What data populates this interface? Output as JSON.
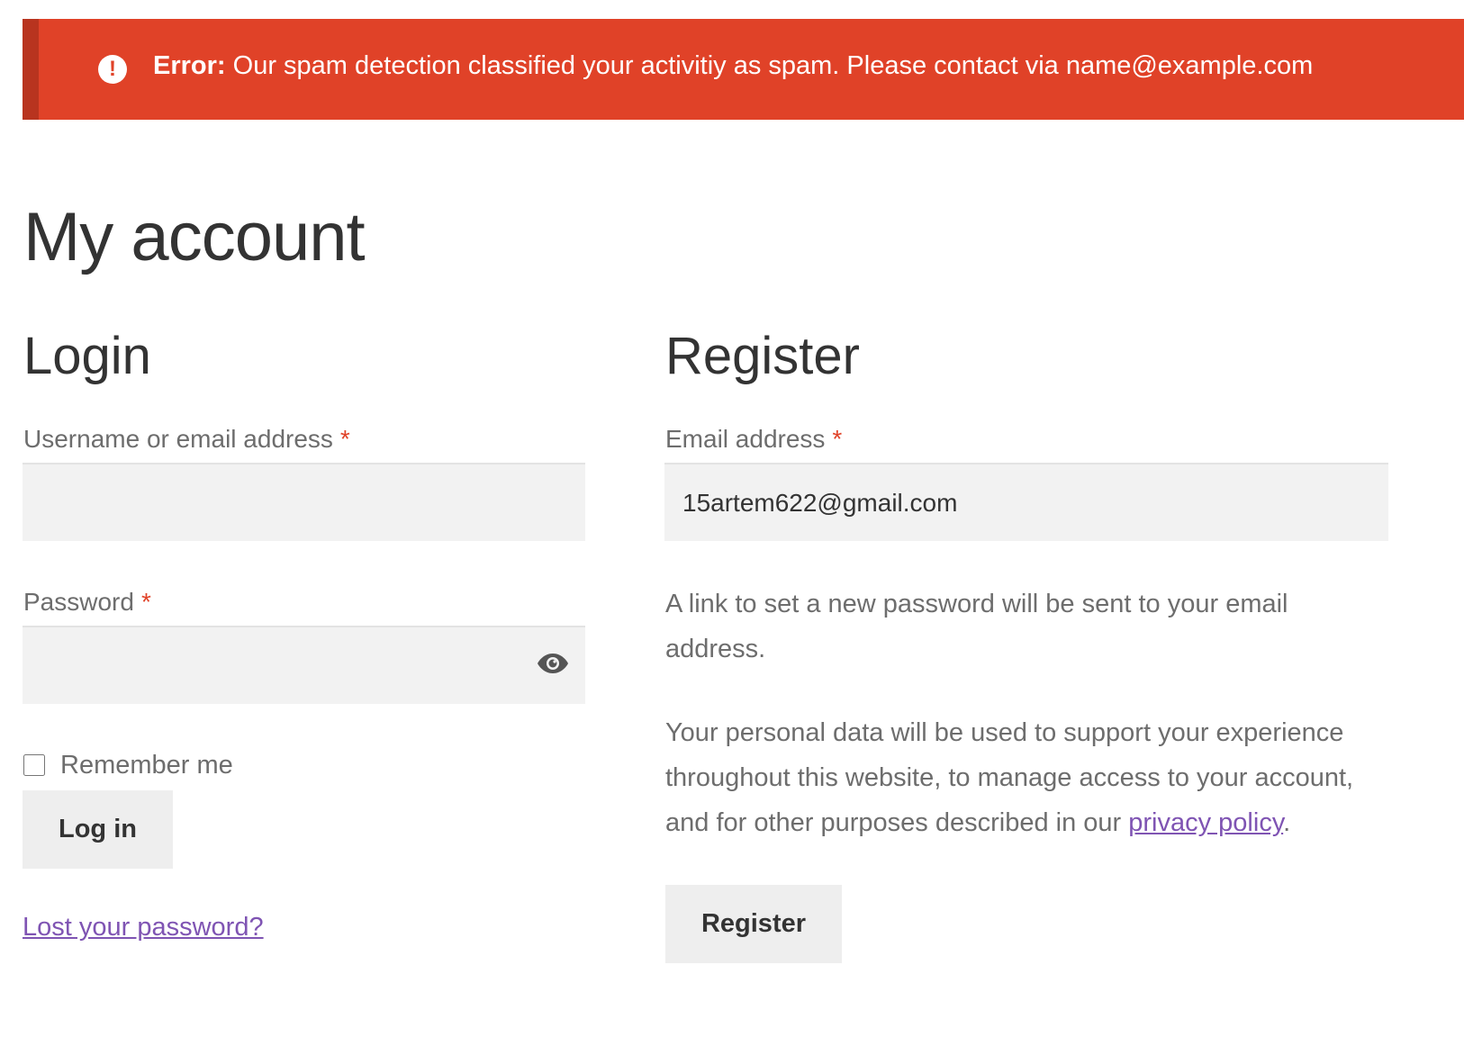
{
  "alert": {
    "label": "Error:",
    "message": "Our spam detection classified your activitiy as spam. Please contact via name@example.com",
    "icon": "exclamation-circle-icon",
    "color": "#e04228"
  },
  "page": {
    "title": "My account"
  },
  "login": {
    "heading": "Login",
    "username_label": "Username or email address",
    "username_value": "",
    "password_label": "Password",
    "password_value": "",
    "required_mark": "*",
    "remember_label": "Remember me",
    "login_button": "Log in",
    "lost_password_link": "Lost your password?"
  },
  "register": {
    "heading": "Register",
    "email_label": "Email address",
    "email_value": "15artem622@gmail.com",
    "required_mark": "*",
    "password_note": "A link to set a new password will be sent to your email address.",
    "privacy_text": "Your personal data will be used to support your experience throughout this website, to manage access to your account, and for other purposes described in our ",
    "privacy_link": "privacy policy",
    "privacy_end": ".",
    "register_button": "Register"
  },
  "colors": {
    "link": "#7f54b3",
    "error": "#e04228"
  }
}
